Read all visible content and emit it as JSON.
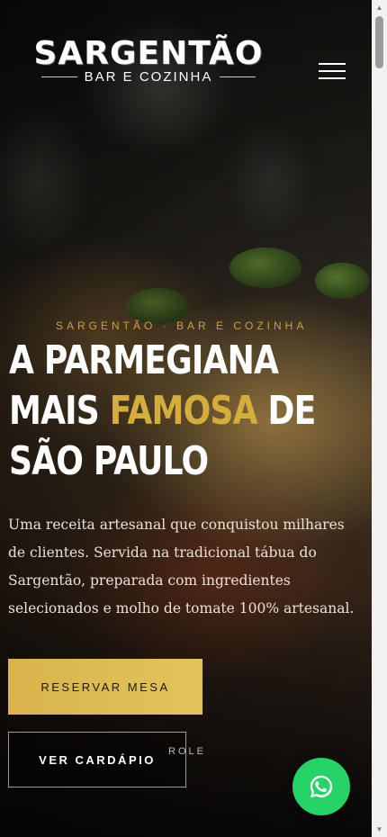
{
  "header": {
    "logo_title": "SARGENTÃO",
    "logo_subtitle": "BAR E COZINHA",
    "menu_icon": "hamburger-menu-icon"
  },
  "hero": {
    "eyebrow": "SARGENTÃO · BAR E COZINHA",
    "headline_line1": "A PARMEGIANA",
    "headline_line2_a": "MAIS ",
    "headline_line2_highlight": "FAMOSA",
    "headline_line2_b": " DE",
    "headline_line3": "SÃO PAULO",
    "description": "Uma receita artesanal que conquistou milhares de clientes. Servida na tradicional tábua do Sargentão, preparada com ingredientes selecionados e molho de tomate 100% artesanal.",
    "primary_button": "RESERVAR MESA",
    "secondary_button": "VER CARDÁPIO",
    "scroll_hint": "ROLE"
  },
  "whatsapp": {
    "icon": "whatsapp-icon"
  },
  "colors": {
    "accent_gold": "#d4ad3b",
    "button_gold": "#dcb84f",
    "whatsapp_green": "#25d366"
  }
}
